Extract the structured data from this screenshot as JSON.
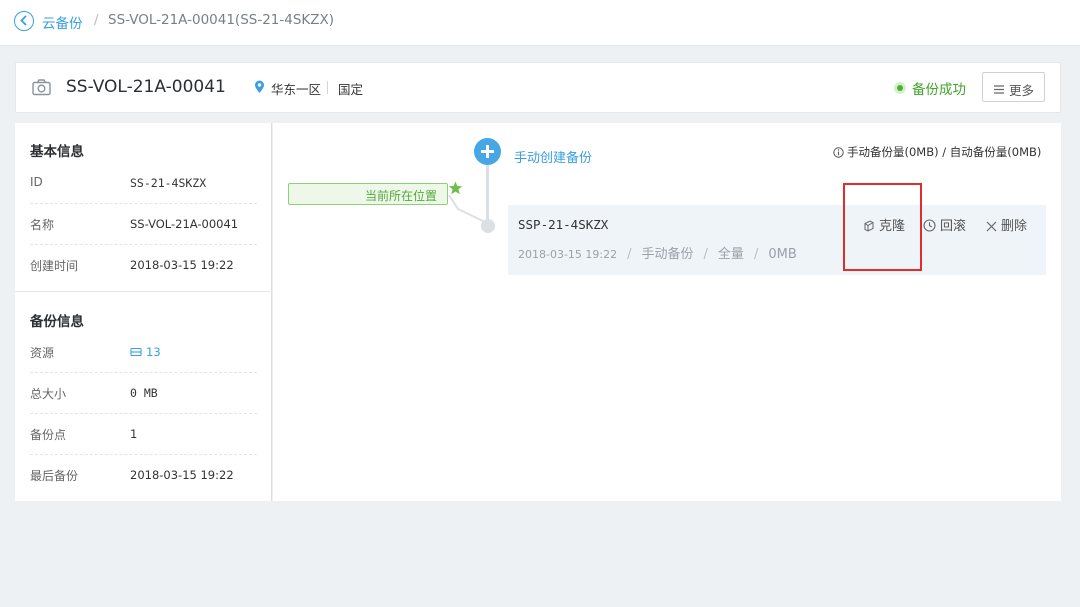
{
  "breadcrumb": {
    "parent": "云备份",
    "separator": "/",
    "current": "SS-VOL-21A-00041(SS-21-4SKZX)"
  },
  "header": {
    "title": "SS-VOL-21A-00041",
    "zone": "华东一区",
    "mode": "国定",
    "status": "备份成功",
    "more_label": "更多"
  },
  "basic_info": {
    "title": "基本信息",
    "rows": [
      {
        "key": "ID",
        "value": "SS-21-4SKZX"
      },
      {
        "key": "名称",
        "value": "SS-VOL-21A-00041"
      },
      {
        "key": "创建时间",
        "value": "2018-03-15 19:22"
      }
    ]
  },
  "backup_info": {
    "title": "备份信息",
    "rows": [
      {
        "key": "资源",
        "value": "13"
      },
      {
        "key": "总大小",
        "value": "0 MB"
      },
      {
        "key": "备份点",
        "value": "1"
      },
      {
        "key": "最后备份",
        "value": "2018-03-15 19:22"
      }
    ]
  },
  "timeline": {
    "create_label": "手动创建备份",
    "quota_text": "手动备份量(0MB) / 自动备份量(0MB)",
    "position_tag": "当前所在位置",
    "item": {
      "name": "SSP-21-4SKZX",
      "date": "2018-03-15 19:22",
      "type": "手动备份",
      "scope": "全量",
      "size": "0MB",
      "actions": {
        "clone": "克隆",
        "rollback": "回滚",
        "delete": "删除"
      }
    }
  },
  "colors": {
    "accent": "#3a9fde",
    "success": "#41a32a",
    "highlight": "#e22b2b"
  }
}
